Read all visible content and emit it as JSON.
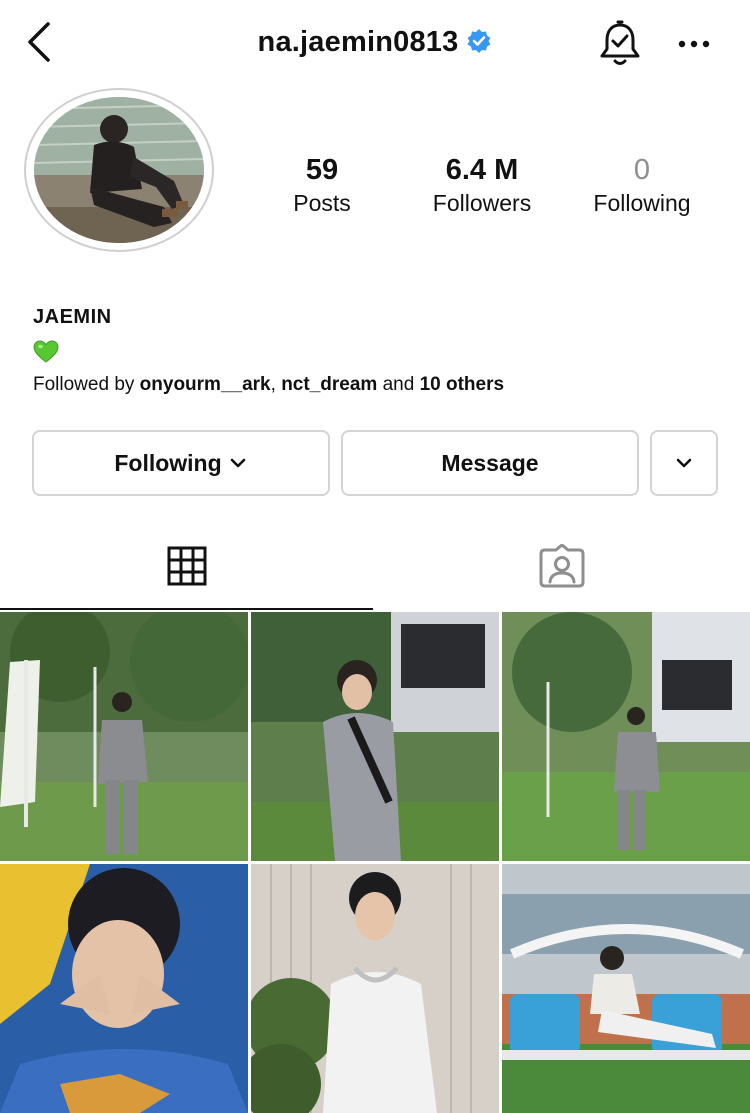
{
  "header": {
    "username": "na.jaemin0813",
    "icons": [
      "back-icon",
      "verified-badge-icon",
      "notification-bell-icon",
      "more-options-icon"
    ]
  },
  "stats": [
    {
      "value": "59",
      "label": "Posts"
    },
    {
      "value": "6.4 M",
      "label": "Followers"
    },
    {
      "value": "0",
      "label": "Following"
    }
  ],
  "bio": {
    "name": "JAEMIN",
    "emoji": "green-heart-icon",
    "followed_prefix": "Followed by ",
    "followed_user1": "onyourm__ark",
    "followed_sep": ", ",
    "followed_user2": "nct_dream",
    "followed_and": " and ",
    "followed_others": "10 others"
  },
  "actions": {
    "following_label": "Following",
    "message_label": "Message"
  },
  "tabs": [
    {
      "icon": "grid-icon",
      "active": true
    },
    {
      "icon": "tagged-icon",
      "active": false
    }
  ],
  "colors": {
    "verified": "#3897f0",
    "border": "#d4d4d4",
    "muted": "#8e8e8e",
    "heart": "#58c832"
  }
}
